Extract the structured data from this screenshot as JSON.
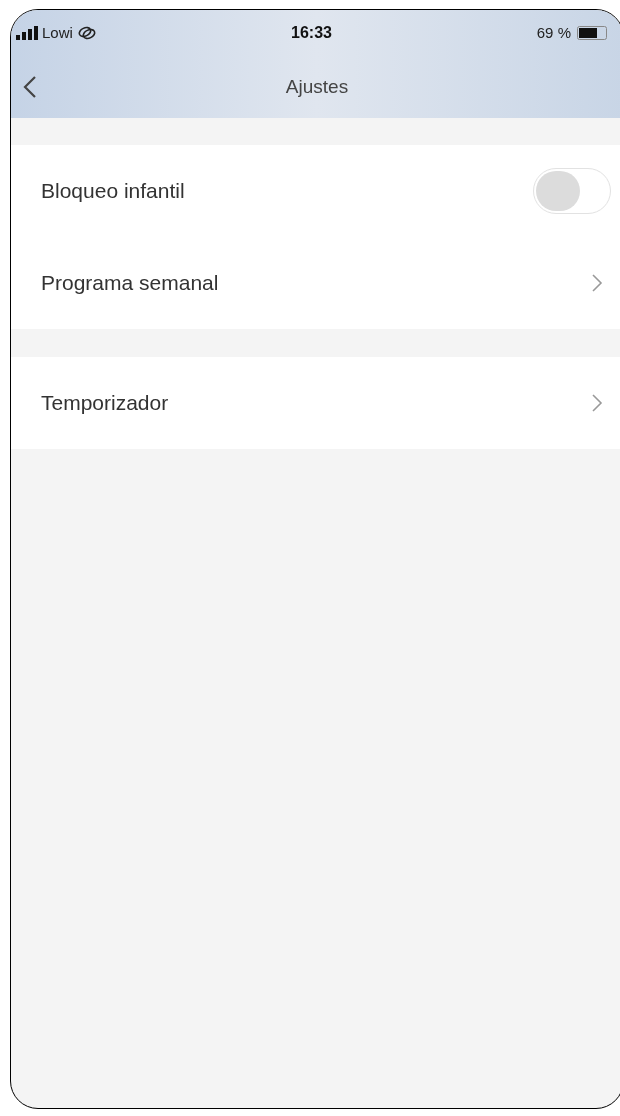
{
  "status_bar": {
    "carrier": "Lowi",
    "time": "16:33",
    "battery": "69 %"
  },
  "nav": {
    "title": "Ajustes"
  },
  "groups": [
    {
      "rows": [
        {
          "kind": "toggle",
          "label": "Bloqueo infantil",
          "on": false
        },
        {
          "kind": "link",
          "label": "Programa semanal"
        }
      ]
    },
    {
      "rows": [
        {
          "kind": "link",
          "label": "Temporizador"
        }
      ]
    }
  ]
}
